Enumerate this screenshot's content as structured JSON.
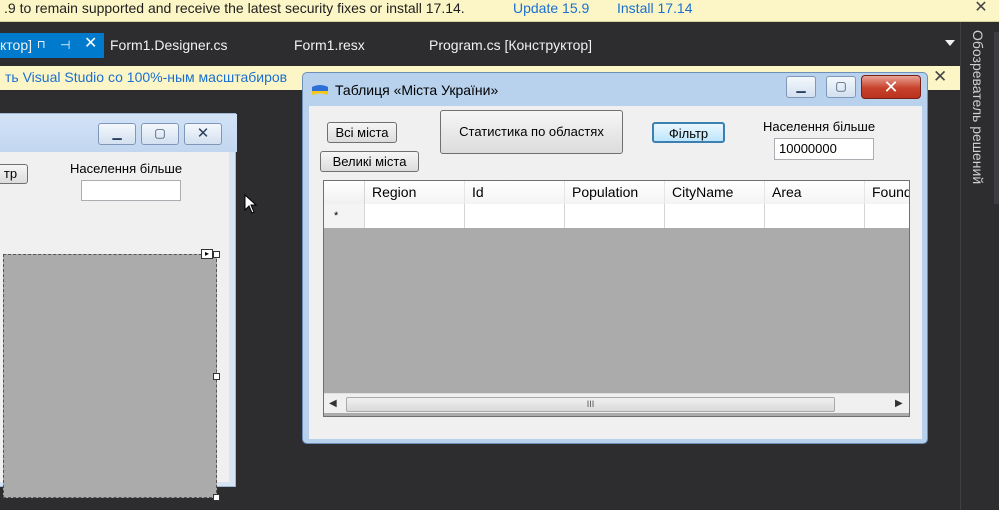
{
  "infobar": {
    "message": ".9 to remain supported and receive the latest security fixes or install 17.14.",
    "update_link": "Update 15.9",
    "install_link": "Install 17.14",
    "close": "✕"
  },
  "tabs": {
    "active_label": "ктор]",
    "active_close": "✕",
    "items": [
      "Form1.Designer.cs",
      "Form1.resx",
      "Program.cs [Конструктор]"
    ]
  },
  "notice": {
    "message": "ть Visual Studio со 100%-ным масштабиров",
    "close": "✕"
  },
  "sidebar": {
    "label": "Обозреватель решений"
  },
  "designer_form": {
    "button_partial": "тр",
    "population_label": "Населення більше",
    "population_value": ""
  },
  "runtime_window": {
    "title": "Таблиця «Міста України»",
    "buttons": {
      "all_cities": "Всі міста",
      "big_cities": "Великі міста",
      "stats": "Статистика по областях",
      "filter": "Фільтр"
    },
    "population_label": "Населення більше",
    "population_value": "10000000",
    "grid": {
      "columns": [
        "Region",
        "Id",
        "Population",
        "CityName",
        "Area",
        "Found"
      ],
      "new_row_marker": "*",
      "scroll_thumb_grip": "III"
    }
  }
}
